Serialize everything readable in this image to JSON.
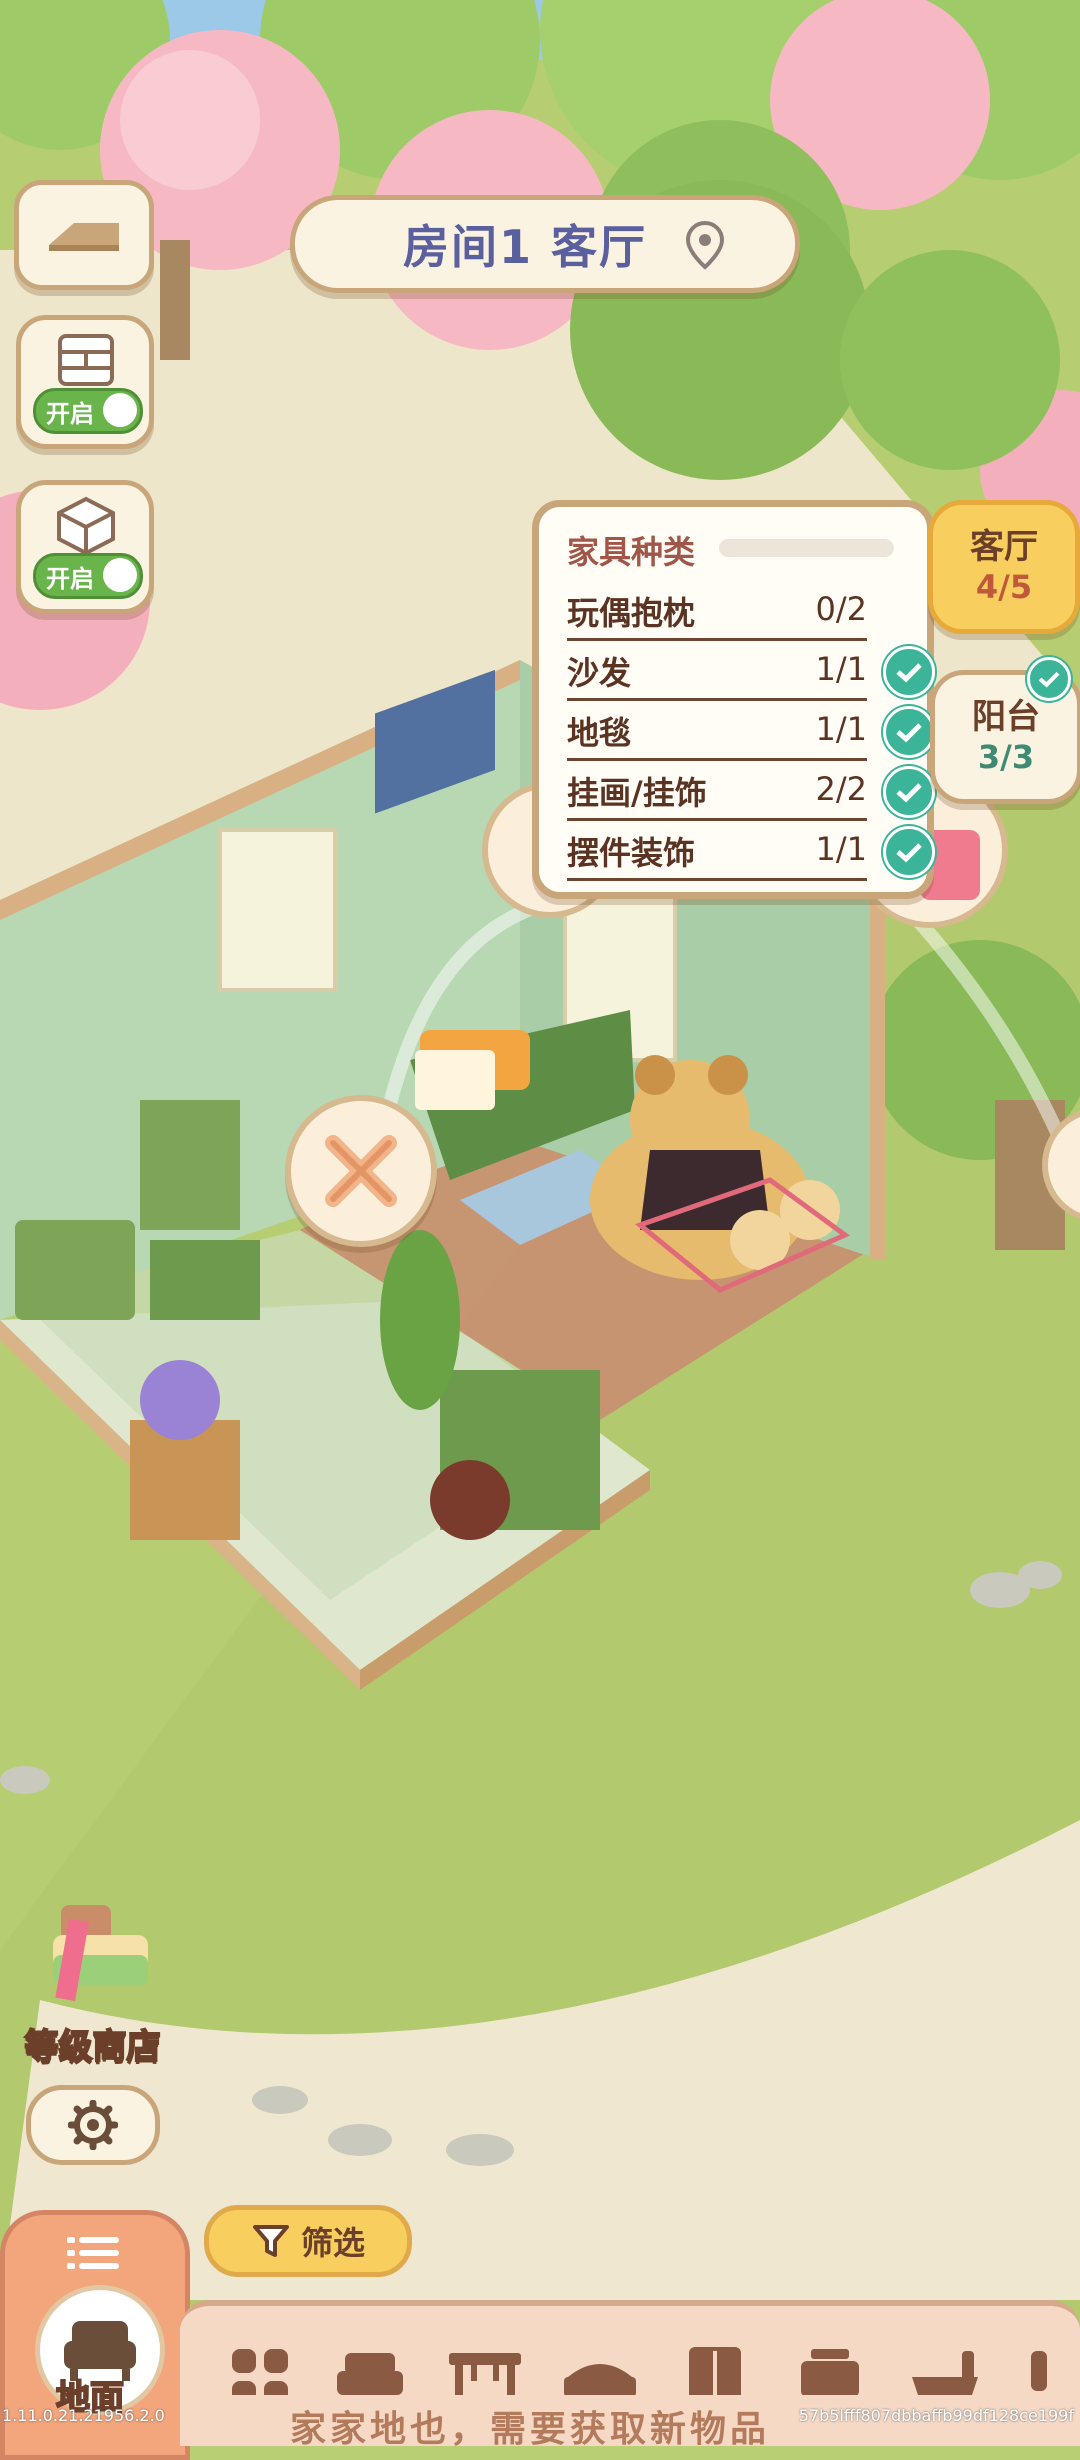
{
  "header": {
    "room_title": "房间1 客厅"
  },
  "side_toggles": [
    {
      "state_label": "开启"
    },
    {
      "state_label": "开启"
    }
  ],
  "furniture_panel": {
    "title": "家具种类",
    "rows": [
      {
        "label": "玩偶抱枕",
        "count": "0/2",
        "complete": false
      },
      {
        "label": "沙发",
        "count": "1/1",
        "complete": true
      },
      {
        "label": "地毯",
        "count": "1/1",
        "complete": true
      },
      {
        "label": "挂画/挂饰",
        "count": "2/2",
        "complete": true
      },
      {
        "label": "摆件装饰",
        "count": "1/1",
        "complete": true
      }
    ]
  },
  "room_tabs": [
    {
      "name": "客厅",
      "count": "4/5",
      "selected": true
    },
    {
      "name": "阳台",
      "count": "3/3",
      "selected": false,
      "complete": true
    }
  ],
  "shop": {
    "label": "等级商店"
  },
  "filter": {
    "label": "筛选"
  },
  "category": {
    "label": "地面"
  },
  "category_icons": [
    "grid-icon",
    "sofa-icon",
    "table-icon",
    "bed-icon",
    "wardrobe-icon",
    "cabinet-icon",
    "bathtub-icon"
  ],
  "bottom_banner": {
    "text": "家家地也，需要获取新物品"
  },
  "footer": {
    "version": "1.11.0.21.21956.2.0",
    "hash": "57b5lfff807dbbaffb99df128ce199f"
  },
  "colors": {
    "accent_yellow": "#f8cf5e",
    "panel_border": "#c9a57a",
    "check_green": "#3cb49a",
    "toggle_green": "#6ab44c",
    "title_blue": "#5a5f9e"
  }
}
